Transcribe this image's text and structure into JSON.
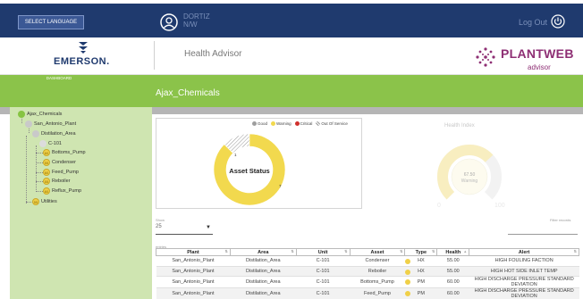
{
  "header": {
    "language_button": "SELECT LANGUAGE",
    "user_name": "DORTIZ",
    "user_role": "N/W",
    "logout_label": "Log Out"
  },
  "brand": {
    "company": "EMERSON.",
    "app_title": "Health Advisor",
    "product_name": "PLANTWEB",
    "product_sub": "advisor"
  },
  "nav": {
    "tab_dashboard": "DASHBOARD"
  },
  "page": {
    "title": "Ajax_Chemicals"
  },
  "tree": {
    "nodes": [
      {
        "label": "Ajax_Chemicals",
        "marker": ""
      },
      {
        "label": "San_Antonio_Plant",
        "marker": ""
      },
      {
        "label": "Distilation_Area",
        "marker": ""
      },
      {
        "label": "C-101",
        "marker": ""
      },
      {
        "label": "Bottoms_Pump",
        "marker": "60"
      },
      {
        "label": "Condenser",
        "marker": "55"
      },
      {
        "label": "Feed_Pump",
        "marker": "60"
      },
      {
        "label": "Reboiler",
        "marker": "55"
      },
      {
        "label": "Reflux_Pump",
        "marker": "60"
      },
      {
        "label": "Utilities",
        "marker": "55"
      }
    ]
  },
  "asset_status": {
    "title": "Asset Status",
    "legend": [
      "Good",
      "Warning",
      "Critical",
      "Out Of Service"
    ],
    "colors": {
      "good": "#9e9e9e",
      "warning": "#f2d94e",
      "critical": "#d0312d",
      "out_of_service": "#c8c8c8"
    },
    "warning_count": "7",
    "out_of_service_count": "1"
  },
  "chart_data": {
    "type": "pie",
    "title": "Asset Status",
    "categories": [
      "Warning",
      "Out Of Service"
    ],
    "values": [
      7,
      1
    ],
    "legend_position": "top"
  },
  "health_index": {
    "title": "Health Index",
    "value": "67.50",
    "status": "Warning",
    "min": "0",
    "max": "100",
    "fraction": 0.675
  },
  "table_controls": {
    "show_label": "Show",
    "show_value": "25",
    "filter_label": "Filter records",
    "entries_label": "entries"
  },
  "table": {
    "columns": [
      "Plant",
      "Area",
      "Unit",
      "Asset",
      "Type",
      "Health",
      "Alert"
    ],
    "rows": [
      [
        "San_Antonio_Plant",
        "Distilation_Area",
        "C-101",
        "Condenser",
        "HX",
        "55.00",
        "HIGH FOULING FACTION"
      ],
      [
        "San_Antonio_Plant",
        "Distilation_Area",
        "C-101",
        "Reboiler",
        "HX",
        "55.00",
        "HIGH HOT SIDE INLET TEMP"
      ],
      [
        "San_Antonio_Plant",
        "Distilation_Area",
        "C-101",
        "Bottoms_Pump",
        "PM",
        "60.00",
        "HIGH DISCHARGE PRESSURE STANDARD DEVIATION"
      ],
      [
        "San_Antonio_Plant",
        "Distilation_Area",
        "C-101",
        "Feed_Pump",
        "PM",
        "60.00",
        "HIGH DISCHARGE PRESSURE STANDARD DEVIATION"
      ]
    ]
  }
}
